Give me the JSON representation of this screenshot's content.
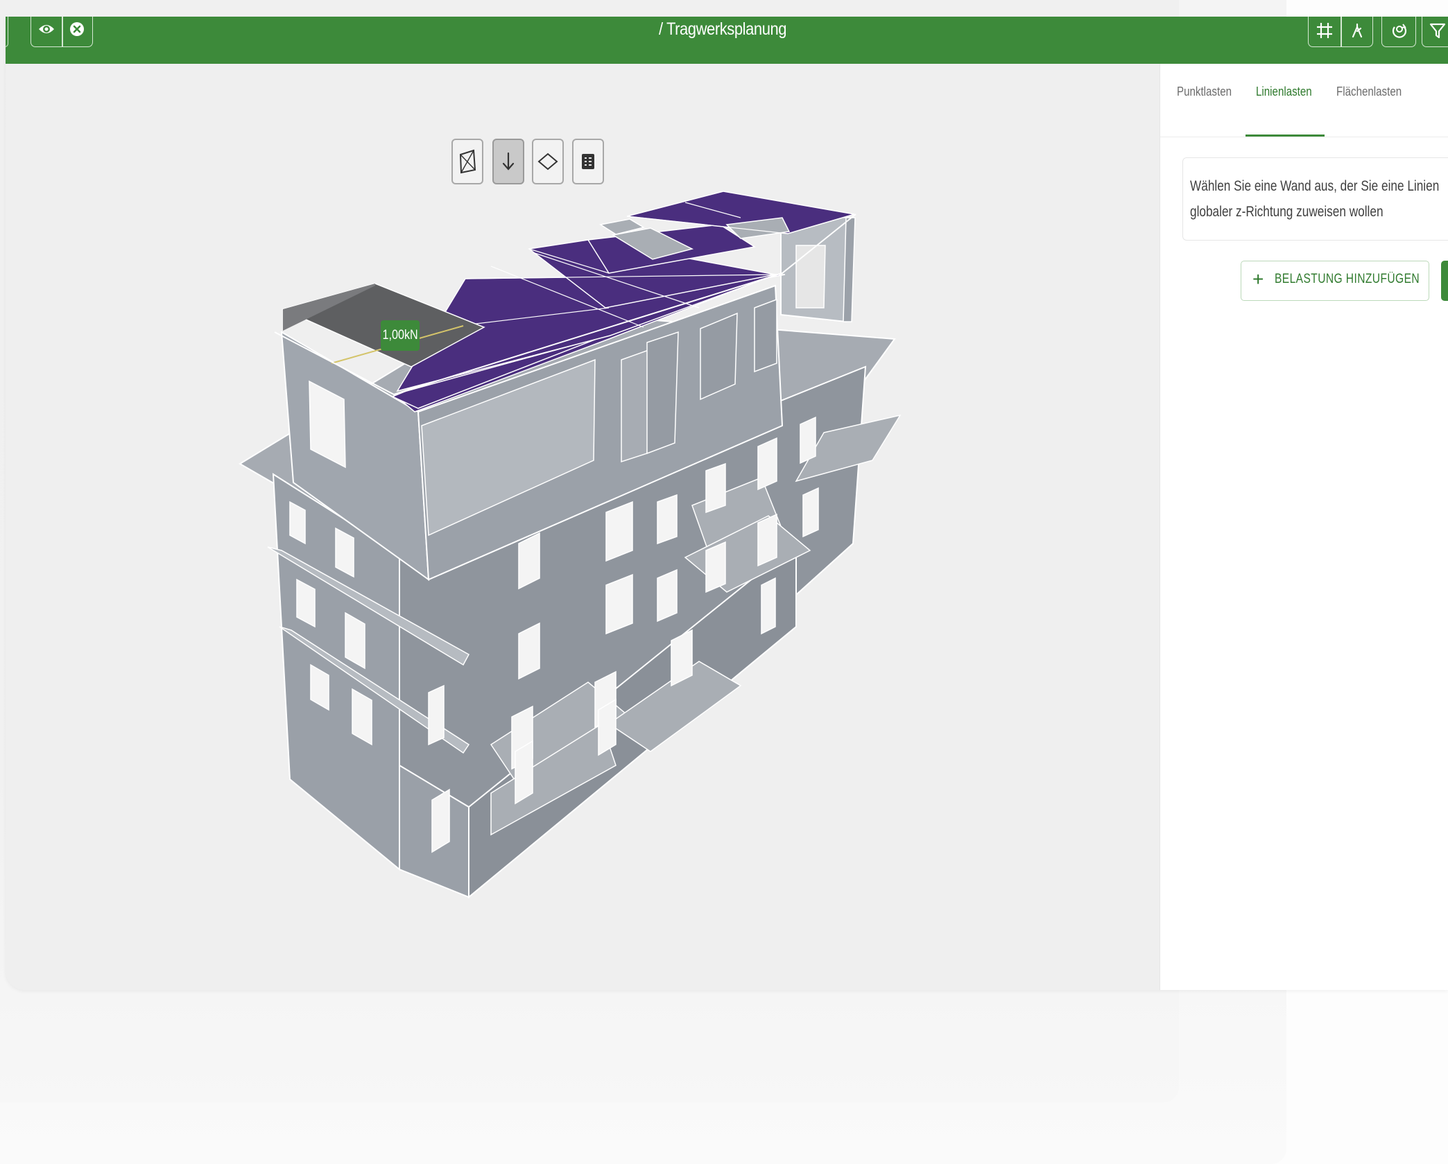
{
  "header": {
    "title": "/ Tragwerksplanung",
    "left_icons": [
      "eye-icon",
      "close-circle-icon"
    ],
    "right_icons": [
      "grid-icon",
      "person-icon",
      "rotate-icon",
      "filter-icon"
    ]
  },
  "viewport": {
    "tools": [
      "view-cube-icon",
      "arrow-down-icon",
      "diamond-icon",
      "list-icon"
    ],
    "active_tool": "arrow-down-icon",
    "load_label": "1,00kN"
  },
  "side_panel": {
    "tabs": [
      {
        "label": "Punktlasten",
        "active": false
      },
      {
        "label": "Linienlasten",
        "active": true
      },
      {
        "label": "Flächenlasten",
        "active": false
      }
    ],
    "info_line1": "Wählen Sie eine Wand aus, der Sie eine Linien",
    "info_line2": "globaler z-Richtung zuweisen wollen",
    "add_button": "BELASTUNG HINZUFÜGEN"
  },
  "colors": {
    "brand_green": "#3d8a3a",
    "load_purple": "#4a2e7e",
    "wall_gray": "#9aa1a9"
  }
}
